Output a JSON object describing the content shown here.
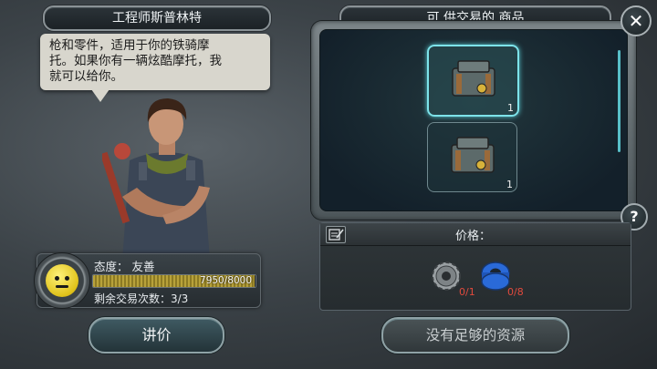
{
  "npc": {
    "title": "工程师斯普林特",
    "dialogue": "枪和零件，适用于你的铁骑摩\n托。如果你有一辆炫酷摩托，我\n就可以给你。"
  },
  "attitude": {
    "label": "态度：  友善",
    "progress_text": "7950/8000",
    "progress_fraction": 0.99375,
    "trades_left": "剩余交易次数：3/3"
  },
  "buttons": {
    "haggle": "讲价",
    "trade": "没有足够的资源"
  },
  "shop": {
    "title": "可 供交易的 商品",
    "items": [
      {
        "name": "crate-icon",
        "count": "1",
        "selected": true
      },
      {
        "name": "crate-icon",
        "count": "1",
        "selected": false
      }
    ]
  },
  "price": {
    "label": "价格：",
    "requirements": [
      {
        "icon": "gear-icon",
        "amount": "0/1"
      },
      {
        "icon": "tape-icon",
        "amount": "0/8"
      }
    ]
  },
  "icons": {
    "close": "close-icon",
    "help": "help-icon",
    "note": "note-icon"
  },
  "colors": {
    "accent": "#7de3ea",
    "requirement_missing": "#e24a3d"
  }
}
